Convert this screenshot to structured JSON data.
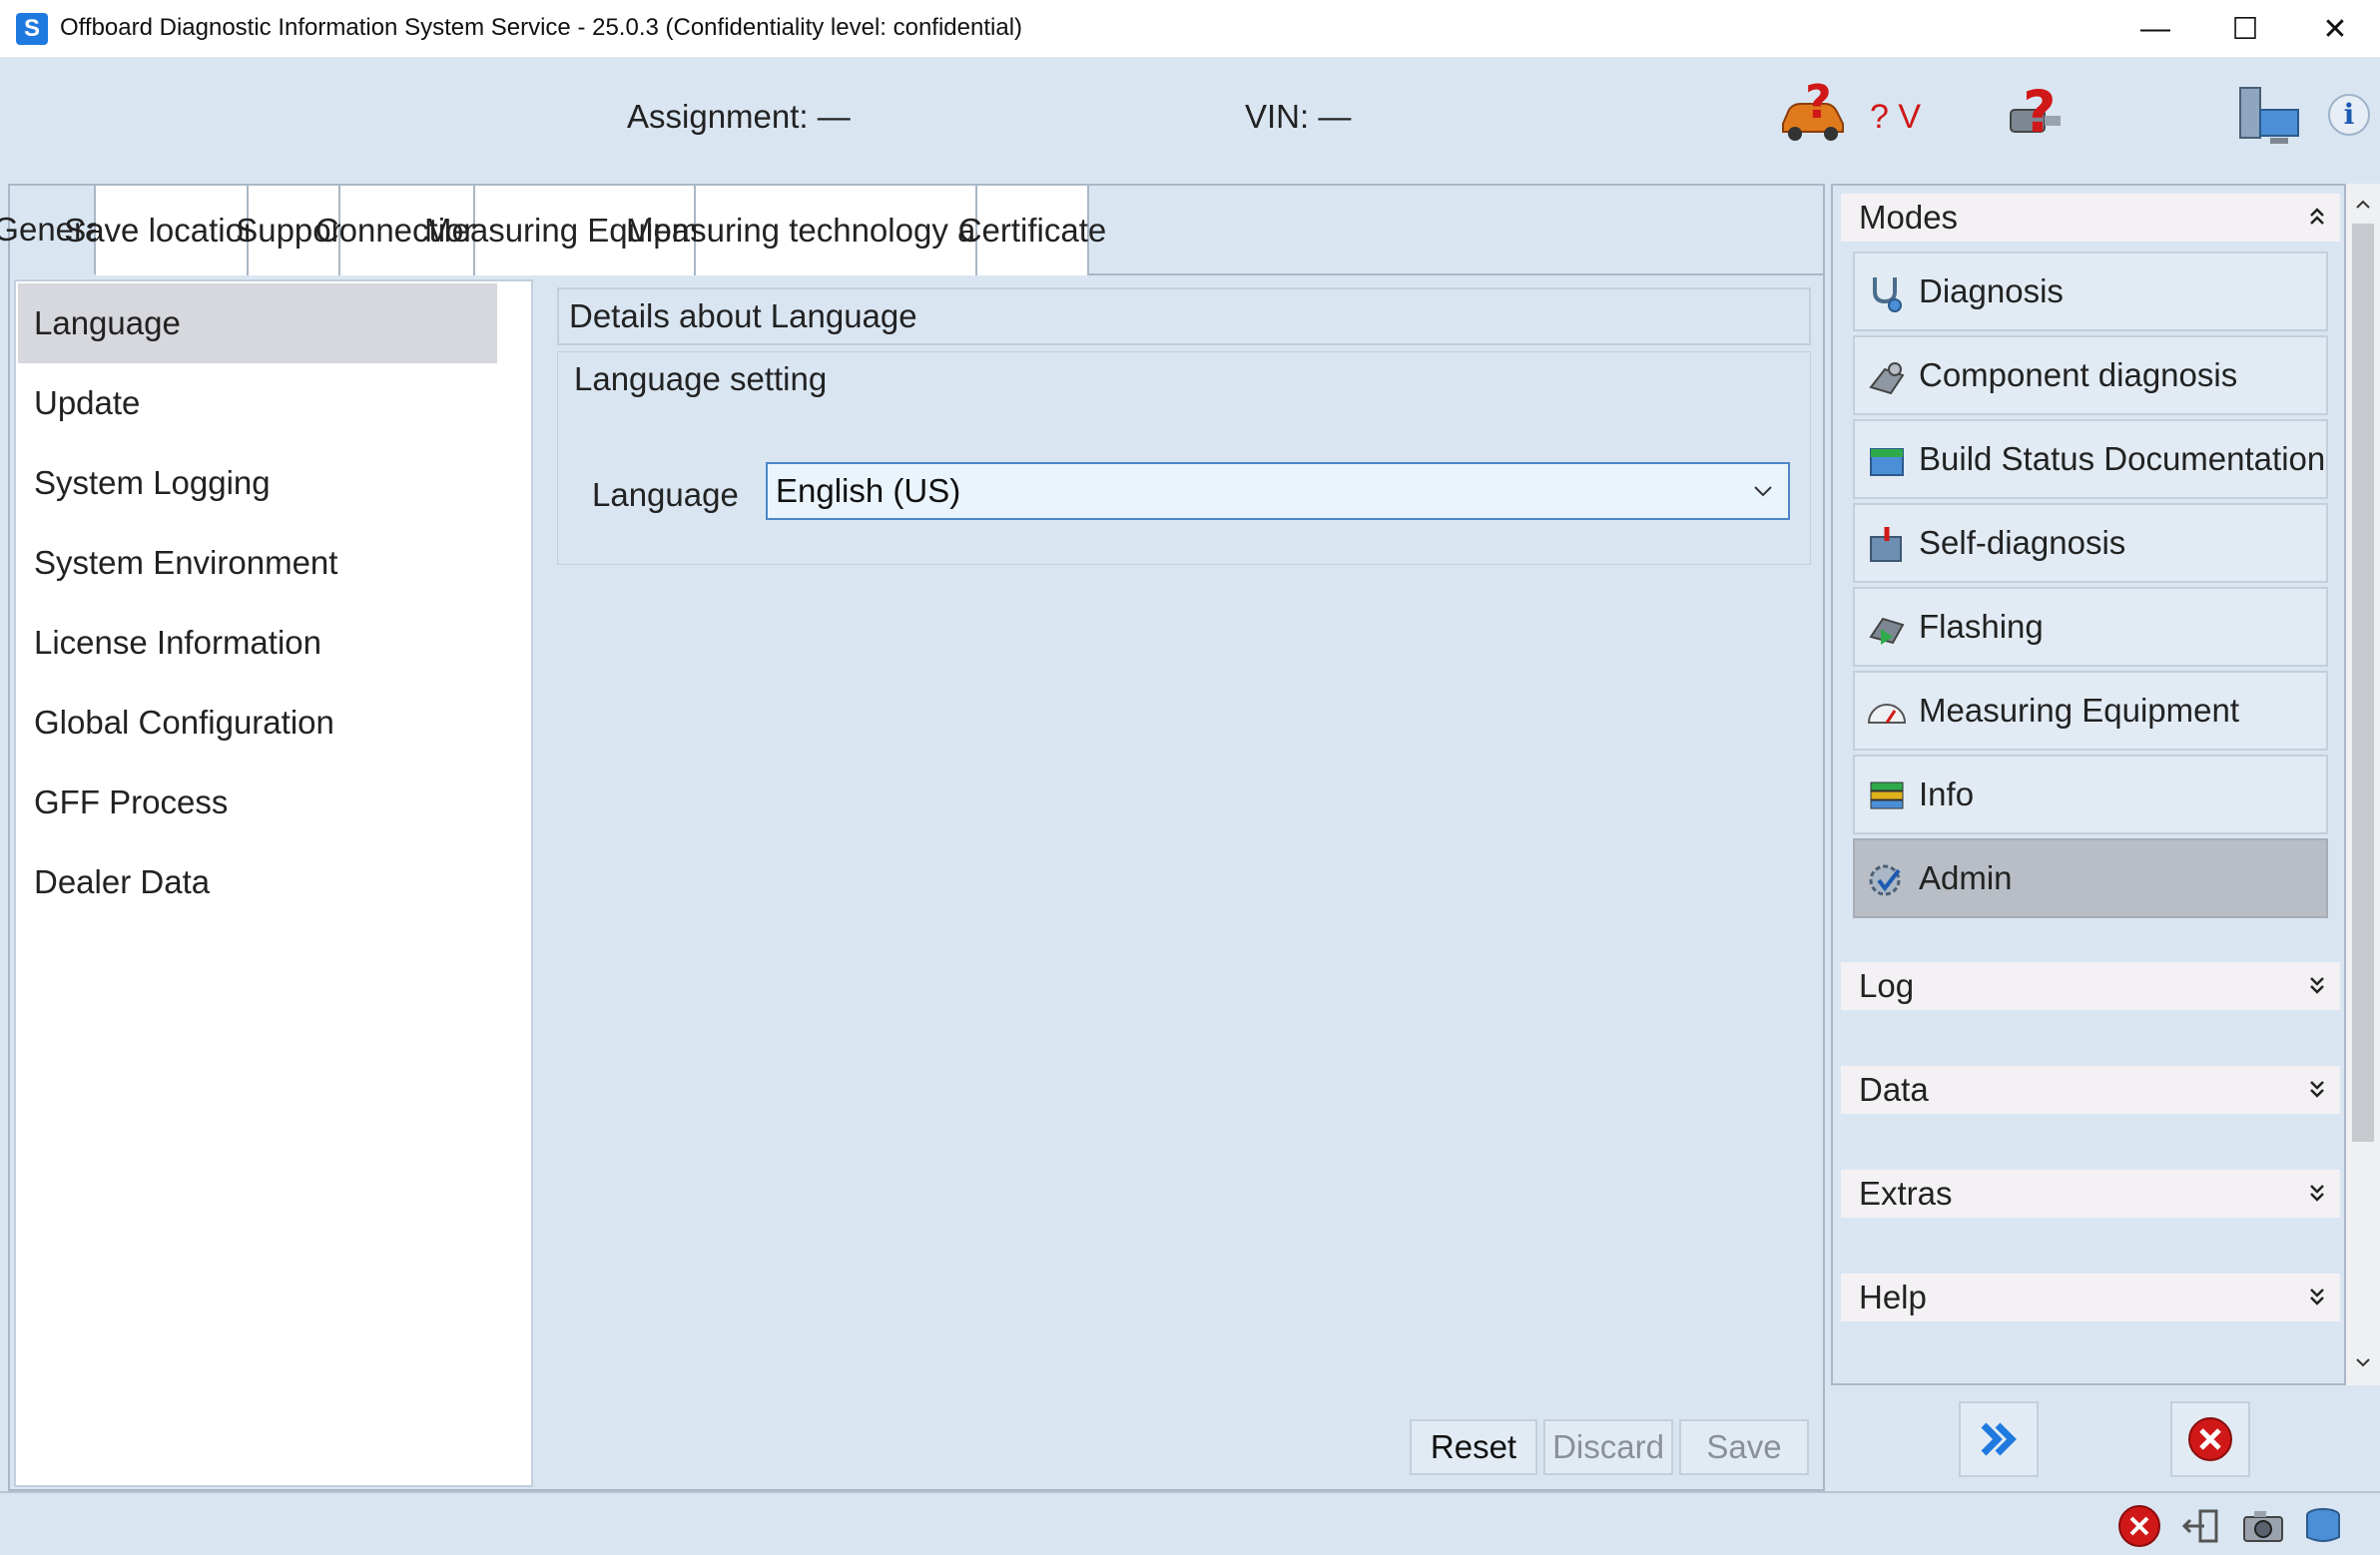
{
  "window": {
    "title": "Offboard Diagnostic Information System Service - 25.0.3 (Confidentiality level: confidential)",
    "app_icon_letter": "S",
    "minimize": "—",
    "maximize": "☐",
    "close": "✕"
  },
  "header": {
    "assignment": "Assignment:  —",
    "vin": "VIN:  —",
    "voltage": "? V",
    "info_letter": "i"
  },
  "tabs": [
    {
      "label": "General"
    },
    {
      "label": "Save locations"
    },
    {
      "label": "Support"
    },
    {
      "label": "Connections"
    },
    {
      "label": "Measuring Equipment"
    },
    {
      "label": "Measuring technology action"
    },
    {
      "label": "Certificate"
    }
  ],
  "nav": [
    {
      "label": "Language"
    },
    {
      "label": "Update"
    },
    {
      "label": "System Logging"
    },
    {
      "label": "System Environment"
    },
    {
      "label": "License Information"
    },
    {
      "label": "Global Configuration"
    },
    {
      "label": "GFF Process"
    },
    {
      "label": "Dealer Data"
    }
  ],
  "details": {
    "header": "Details about Language",
    "group_title": "Language setting",
    "language_label": "Language",
    "language_value": "English (US)"
  },
  "actions": {
    "reset": "Reset",
    "discard": "Discard",
    "save": "Save"
  },
  "sidebar": {
    "modes_title": "Modes",
    "modes": [
      {
        "label": "Diagnosis",
        "icon": "stethoscope-icon"
      },
      {
        "label": "Component diagnosis",
        "icon": "component-icon"
      },
      {
        "label": "Build Status Documentation",
        "icon": "document-icon"
      },
      {
        "label": "Self-diagnosis",
        "icon": "self-diagnosis-icon"
      },
      {
        "label": "Flashing",
        "icon": "flashing-icon"
      },
      {
        "label": "Measuring Equipment",
        "icon": "gauge-icon"
      },
      {
        "label": "Info",
        "icon": "books-icon"
      },
      {
        "label": "Admin",
        "icon": "admin-gear-icon"
      }
    ],
    "sections": [
      {
        "label": "Log"
      },
      {
        "label": "Data"
      },
      {
        "label": "Extras"
      },
      {
        "label": "Help"
      }
    ]
  },
  "colors": {
    "background": "#d9e6f2",
    "accent_blue": "#1f7ae0",
    "warning_red": "#d01818",
    "selected_gray": "#b9bec6"
  }
}
